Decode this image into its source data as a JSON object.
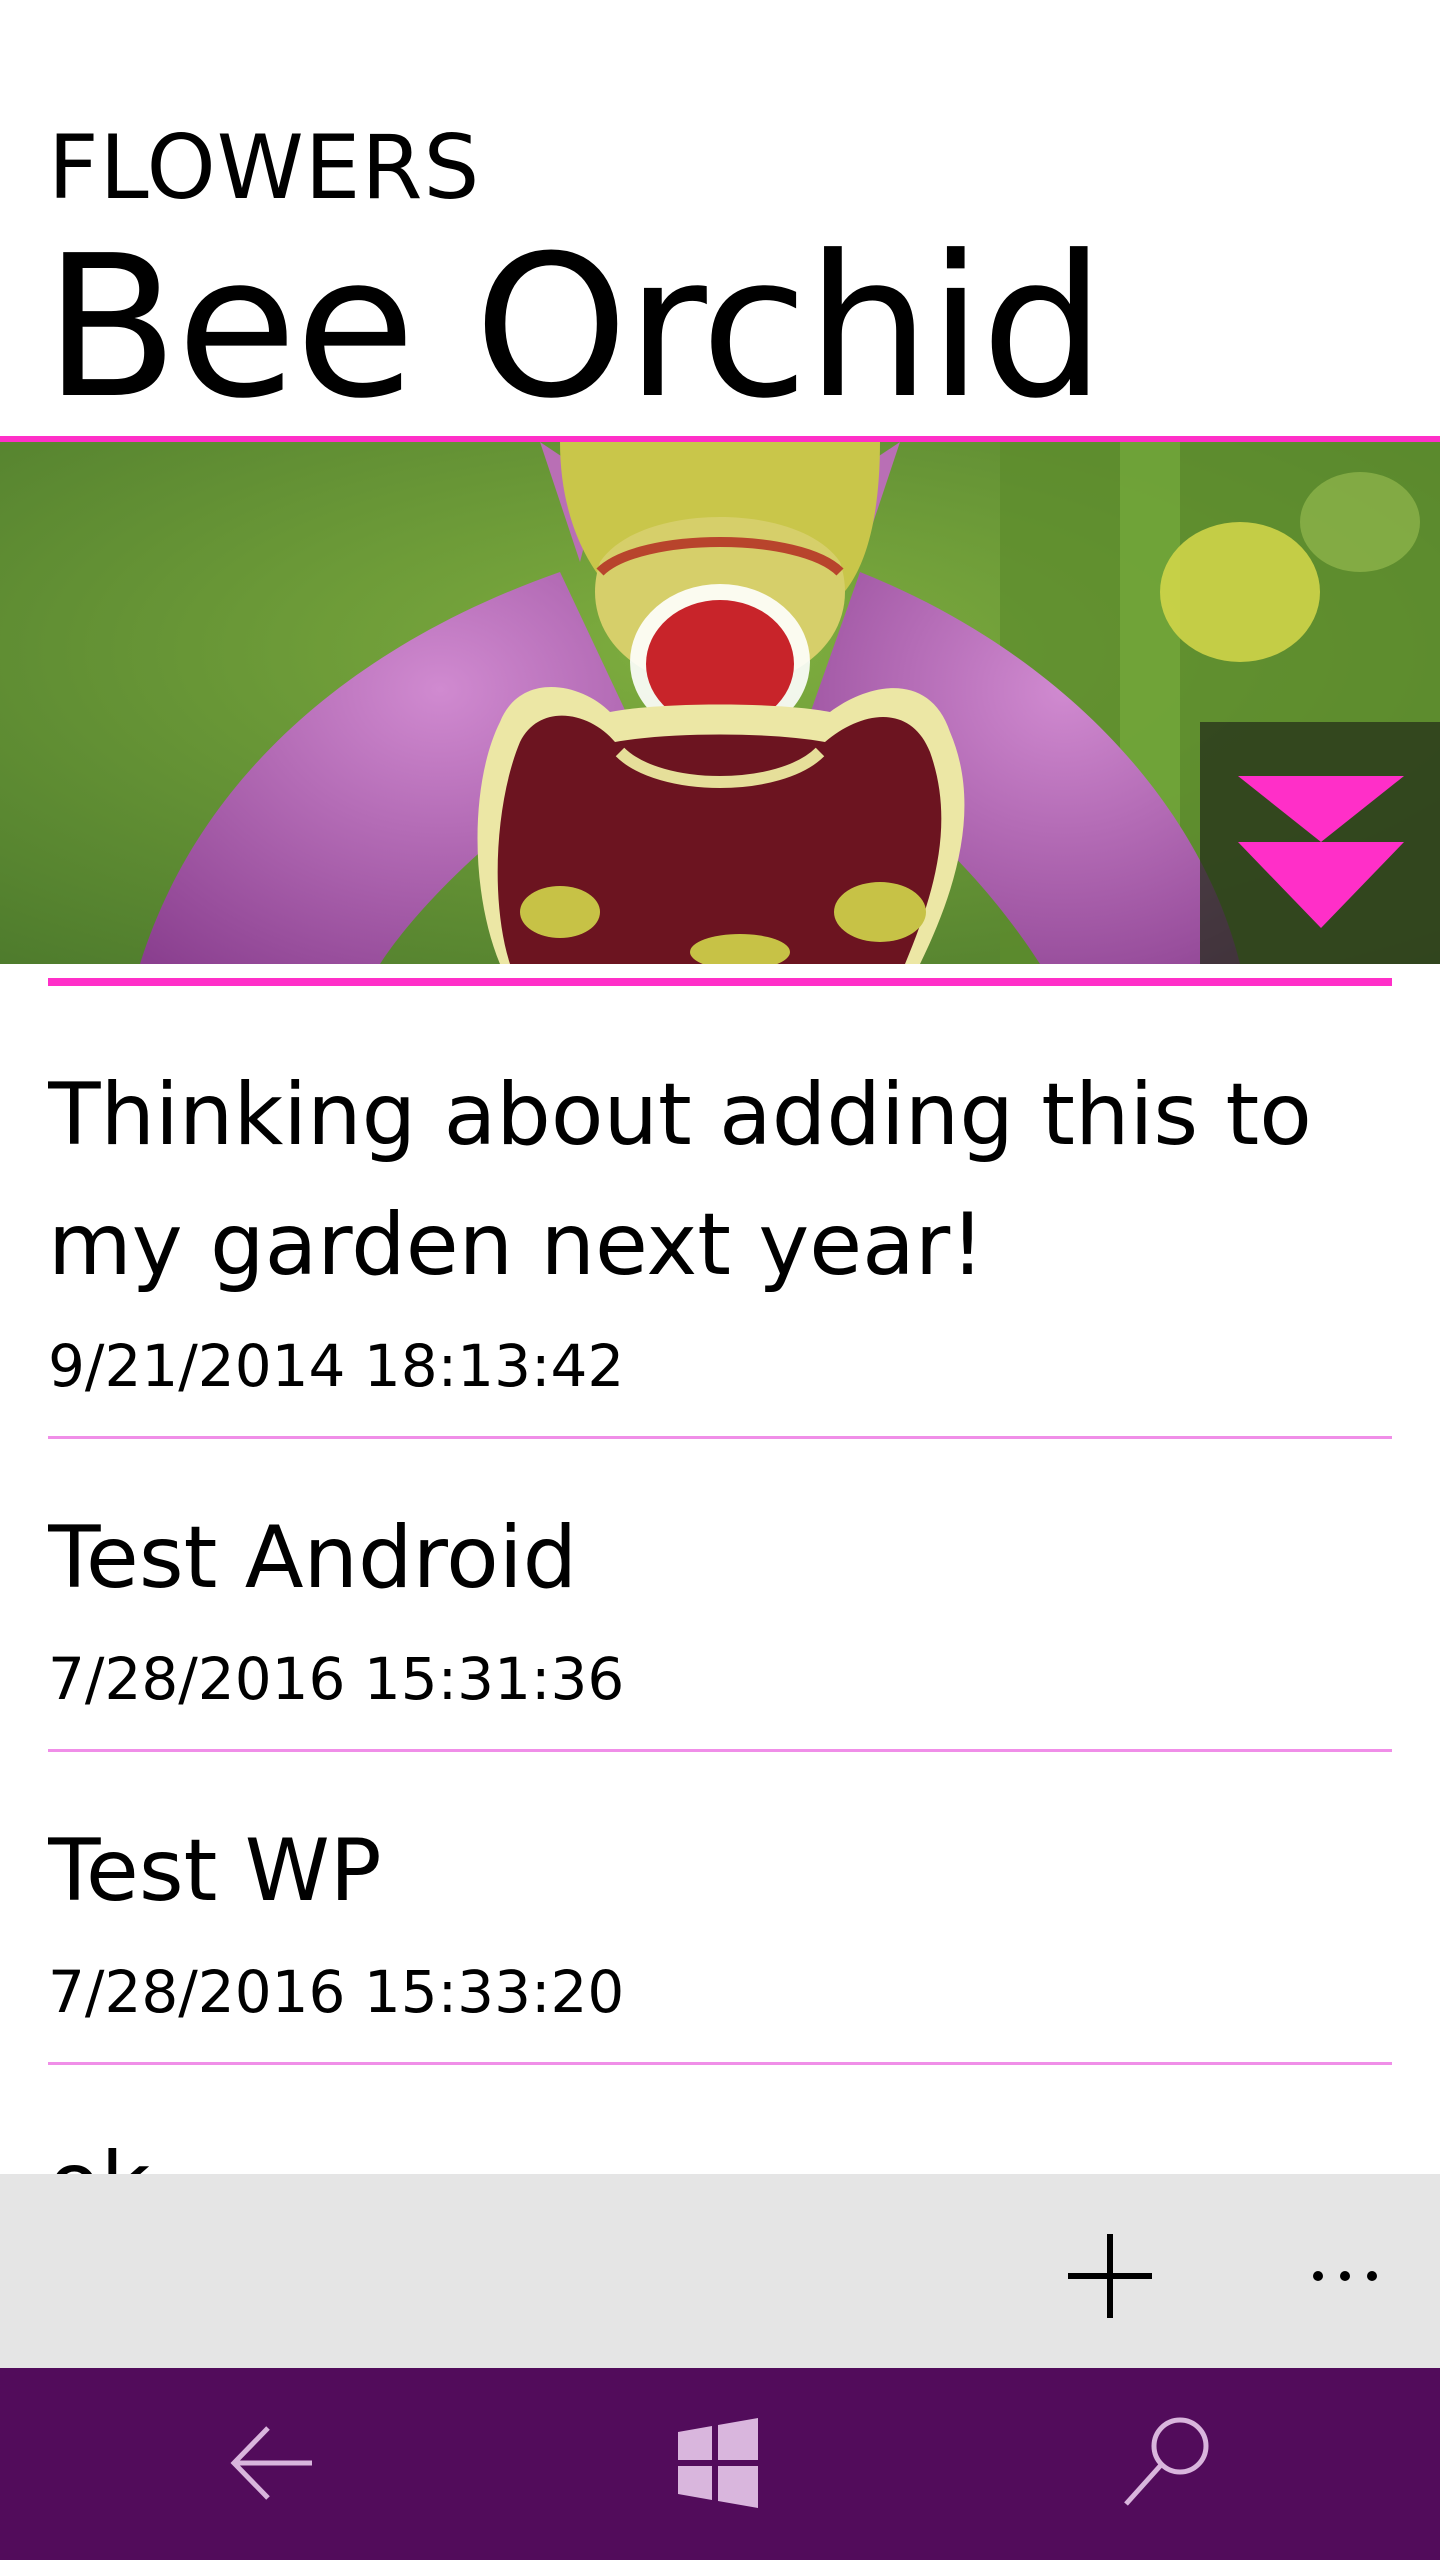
{
  "header": {
    "section": "FLOWERS",
    "title": "Bee Orchid"
  },
  "theme": {
    "accent": "#ff2fc8",
    "divider": "#f08ee8",
    "nav_background": "#520c5b",
    "app_bar_background": "#e5e5e5"
  },
  "hero": {
    "image_icon": "flower-photo",
    "expand_icon": "double-chevron-down-icon"
  },
  "comments": [
    {
      "text": "Thinking about adding this to my garden next year!",
      "timestamp": "9/21/2014 18:13:42"
    },
    {
      "text": "Test Android",
      "timestamp": "7/28/2016 15:31:36"
    },
    {
      "text": "Test WP",
      "timestamp": "7/28/2016 15:33:20"
    },
    {
      "text": "ok",
      "timestamp": ""
    }
  ],
  "app_bar": {
    "add_icon": "plus-icon",
    "more_icon": "ellipsis-icon",
    "more_label": "..."
  },
  "nav_bar": {
    "back_icon": "back-arrow-icon",
    "home_icon": "windows-logo-icon",
    "search_icon": "search-icon"
  }
}
